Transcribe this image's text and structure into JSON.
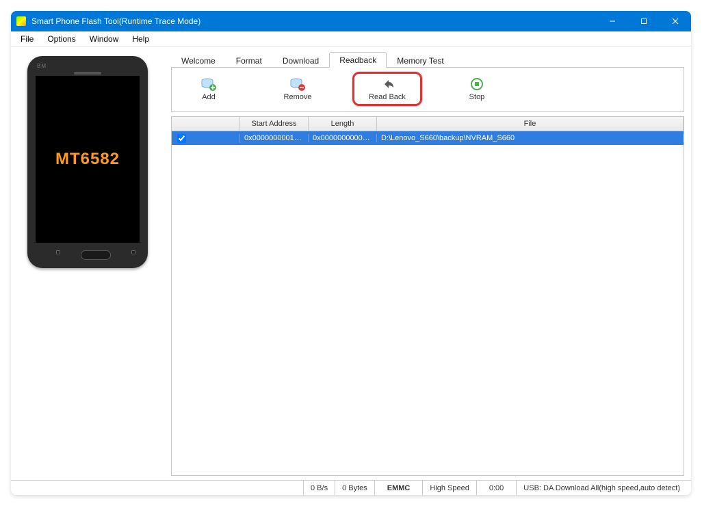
{
  "window": {
    "title": "Smart Phone Flash Tool(Runtime Trace Mode)"
  },
  "menu": {
    "file": "File",
    "options": "Options",
    "window": "Window",
    "help": "Help"
  },
  "phone": {
    "brand": "BM",
    "chip": "MT6582"
  },
  "tabs": {
    "welcome": "Welcome",
    "format": "Format",
    "download": "Download",
    "readback": "Readback",
    "memory_test": "Memory Test",
    "active": "readback"
  },
  "toolbar": {
    "add": "Add",
    "remove": "Remove",
    "read_back": "Read Back",
    "stop": "Stop"
  },
  "grid": {
    "headers": {
      "check": "",
      "start_address": "Start Address",
      "length": "Length",
      "file": "File"
    },
    "rows": [
      {
        "checked": true,
        "start_address": "0x000000000100...",
        "length": "0x000000000050...",
        "file": "D:\\Lenovo_S660\\backup\\NVRAM_S660"
      }
    ]
  },
  "status": {
    "rate": "0 B/s",
    "bytes": "0 Bytes",
    "storage": "EMMC",
    "speed": "High Speed",
    "time": "0:00",
    "usb": "USB: DA Download All(high speed,auto detect)"
  }
}
